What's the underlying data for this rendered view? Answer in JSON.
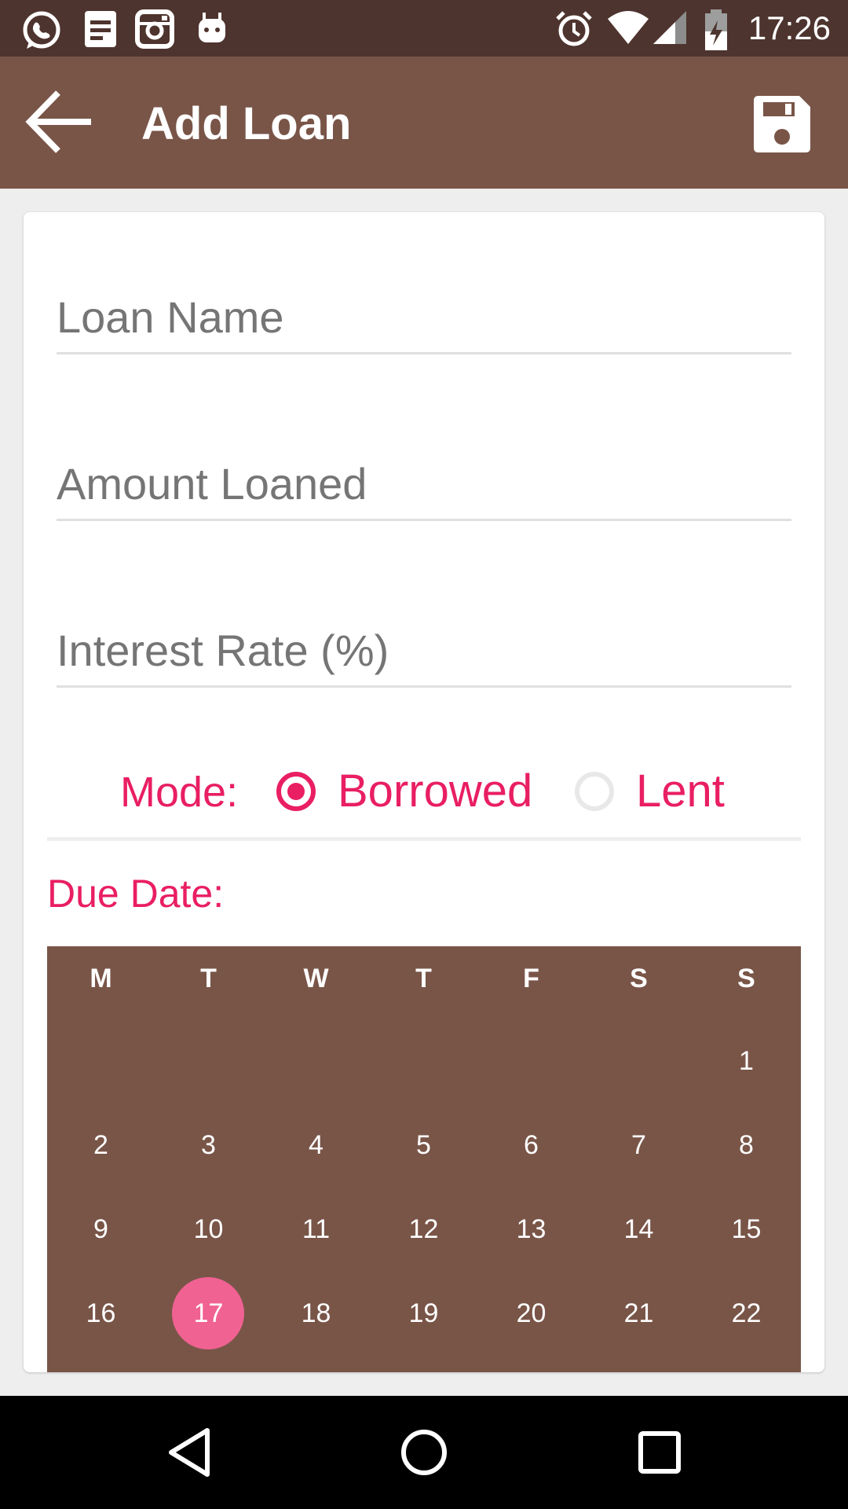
{
  "status_bar": {
    "time": "17:26",
    "icons_left": [
      "whatsapp-icon",
      "notes-icon",
      "instagram-icon",
      "android-icon"
    ],
    "icons_right": [
      "alarm-icon",
      "wifi-icon",
      "signal-icon",
      "battery-charging-icon"
    ]
  },
  "app_bar": {
    "title": "Add Loan",
    "back_icon": "arrow-left-icon",
    "save_icon": "save-floppy-icon"
  },
  "form": {
    "loan_name_placeholder": "Loan Name",
    "loan_name_value": "",
    "amount_placeholder": "Amount Loaned",
    "amount_value": "",
    "interest_placeholder": "Interest Rate (%)",
    "interest_value": "",
    "mode_label": "Mode:",
    "mode_options": [
      {
        "label": "Borrowed",
        "checked": true
      },
      {
        "label": "Lent",
        "checked": false
      }
    ],
    "due_date_label": "Due Date:"
  },
  "calendar": {
    "weekdays": [
      "M",
      "T",
      "W",
      "T",
      "F",
      "S",
      "S"
    ],
    "first_day_column": 6,
    "days": [
      "1",
      "2",
      "3",
      "4",
      "5",
      "6",
      "7",
      "8",
      "9",
      "10",
      "11",
      "12",
      "13",
      "14",
      "15",
      "16",
      "17",
      "18",
      "19",
      "20",
      "21",
      "22"
    ],
    "selected_day": "17",
    "colors": {
      "background": "#795548",
      "selected": "#F06292"
    }
  },
  "colors": {
    "status_bar": "#4E342E",
    "app_bar": "#795548",
    "accent": "#E91E63"
  },
  "nav_bar": {
    "icons": [
      "back-triangle-icon",
      "home-circle-icon",
      "recents-square-icon"
    ]
  }
}
